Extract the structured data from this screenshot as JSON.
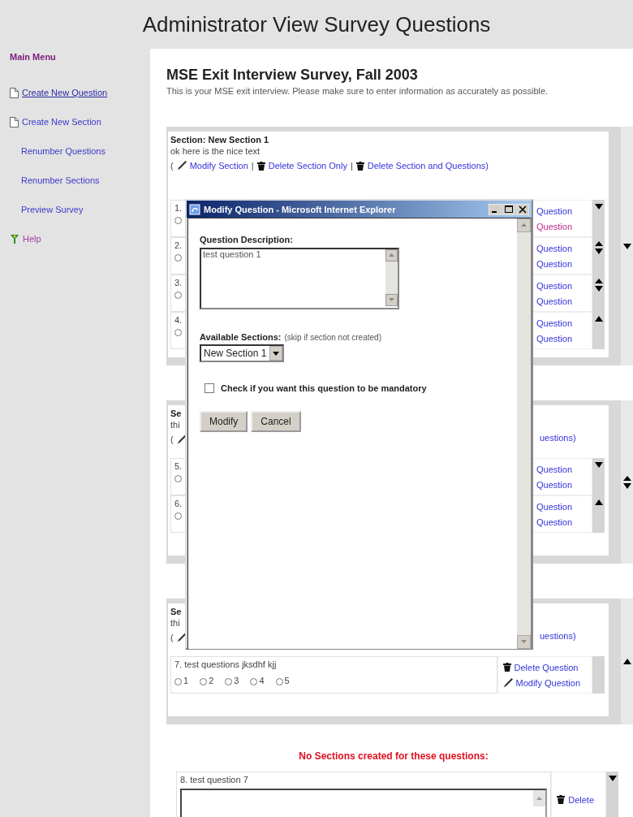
{
  "header": {
    "title": "Administrator View Survey Questions"
  },
  "sidebar": {
    "heading": "Main Menu",
    "items": [
      {
        "kind": "create",
        "label": "Create New Question",
        "underlined": true,
        "visited": false
      },
      {
        "kind": "create",
        "label": "Create New Section",
        "underlined": false,
        "visited": false
      },
      {
        "kind": "plain",
        "label": "Renumber Questions",
        "underlined": false,
        "visited": false
      },
      {
        "kind": "plain",
        "label": "Renumber Sections",
        "underlined": false,
        "visited": false
      },
      {
        "kind": "plain",
        "label": "Preview Survey",
        "underlined": false,
        "visited": false
      },
      {
        "kind": "help",
        "label": "Help",
        "underlined": false,
        "visited": true
      }
    ]
  },
  "survey": {
    "title": "MSE Exit Interview Survey, Fall 2003",
    "description": "This is your MSE exit interview. Please make sure to enter information as accurately as possible."
  },
  "sections": [
    {
      "kind": "full",
      "title": "Section: New Section 1",
      "text": "ok here is the nice text",
      "up": false,
      "down": true,
      "actions": [
        {
          "kind": "text",
          "label": "("
        },
        {
          "kind": "modify",
          "label": "Modify Section"
        },
        {
          "kind": "text",
          "label": "|"
        },
        {
          "kind": "delete",
          "label": "Delete Section Only"
        },
        {
          "kind": "text",
          "label": "|"
        },
        {
          "kind": "delete",
          "label": "Delete Section and Questions)"
        }
      ],
      "questions": [
        {
          "kind": "partial",
          "number": "1.",
          "options": [
            {
              "selected": false
            }
          ],
          "up": false,
          "down": true,
          "links": [
            {
              "kind": "link",
              "label": "Question",
              "visited": false
            },
            {
              "kind": "link",
              "label": "Question",
              "visited": true
            }
          ]
        },
        {
          "kind": "partial",
          "number": "2.",
          "options": [
            {
              "selected": false
            }
          ],
          "up": true,
          "down": true,
          "links": [
            {
              "kind": "link",
              "label": "Question",
              "visited": false
            },
            {
              "kind": "link",
              "label": "Question",
              "visited": false
            }
          ]
        },
        {
          "kind": "partial",
          "number": "3.",
          "options": [
            {
              "selected": false
            }
          ],
          "up": true,
          "down": true,
          "links": [
            {
              "kind": "link",
              "label": "Question",
              "visited": false
            },
            {
              "kind": "link",
              "label": "Question",
              "visited": false
            }
          ]
        },
        {
          "kind": "partial",
          "number": "4.",
          "options": [
            {
              "selected": false
            }
          ],
          "up": true,
          "down": false,
          "links": [
            {
              "kind": "link",
              "label": "Question",
              "visited": false
            },
            {
              "kind": "link",
              "label": "Question",
              "visited": false
            }
          ]
        }
      ]
    },
    {
      "kind": "partial",
      "title": "Se",
      "text": "thi",
      "up": true,
      "down": true,
      "actions": [
        {
          "kind": "text",
          "label": "("
        },
        {
          "kind": "edit"
        },
        {
          "kind": "link",
          "label": "uestions)"
        }
      ],
      "questions": [
        {
          "kind": "partial",
          "number": "5.",
          "options": [
            {
              "selected": false
            }
          ],
          "up": false,
          "down": true,
          "links": [
            {
              "kind": "link",
              "label": "Question",
              "visited": false
            },
            {
              "kind": "link",
              "label": "Question",
              "visited": false
            }
          ]
        },
        {
          "kind": "partial",
          "number": "6.",
          "options": [
            {
              "selected": false
            }
          ],
          "up": true,
          "down": false,
          "links": [
            {
              "kind": "link",
              "label": "Question",
              "visited": false
            },
            {
              "kind": "link",
              "label": "Question",
              "visited": false
            }
          ]
        }
      ]
    },
    {
      "kind": "partial",
      "title": "Se",
      "text": "thi",
      "up": true,
      "down": false,
      "actions": [
        {
          "kind": "text",
          "label": "("
        },
        {
          "kind": "edit"
        },
        {
          "kind": "link",
          "label": "uestions)"
        }
      ],
      "questions": [
        {
          "kind": "radios",
          "text": "7. test questions jksdhf kjj",
          "up": false,
          "down": false,
          "options": [
            {
              "label": "1",
              "selected": false
            },
            {
              "label": "2",
              "selected": false
            },
            {
              "label": "3",
              "selected": false
            },
            {
              "label": "4",
              "selected": false
            },
            {
              "label": "5",
              "selected": false
            }
          ],
          "links": [
            {
              "kind": "delete",
              "label": "Delete Question",
              "visited": false
            },
            {
              "kind": "modify",
              "label": "Modify Question",
              "visited": false
            }
          ]
        }
      ]
    }
  ],
  "unsectioned": {
    "heading": "No Sections created for these questions:",
    "questions": [
      {
        "kind": "textarea",
        "text": "8. test question 7",
        "up": false,
        "down": true,
        "links": [
          {
            "kind": "delete",
            "label": "Delete",
            "visited": false
          }
        ]
      }
    ]
  },
  "popup": {
    "title": "Modify Question - Microsoft Internet Explorer",
    "description_label": "Question Description:",
    "description": "test question 1",
    "sections_label": "Available Sections:",
    "sections_hint": "(skip if section not created)",
    "section": "New Section 1",
    "mandatory": {
      "label": "Check if you want this question to be mandatory",
      "checked": false
    },
    "buttons": [
      {
        "label": "Modify"
      },
      {
        "label": "Cancel"
      }
    ]
  }
}
